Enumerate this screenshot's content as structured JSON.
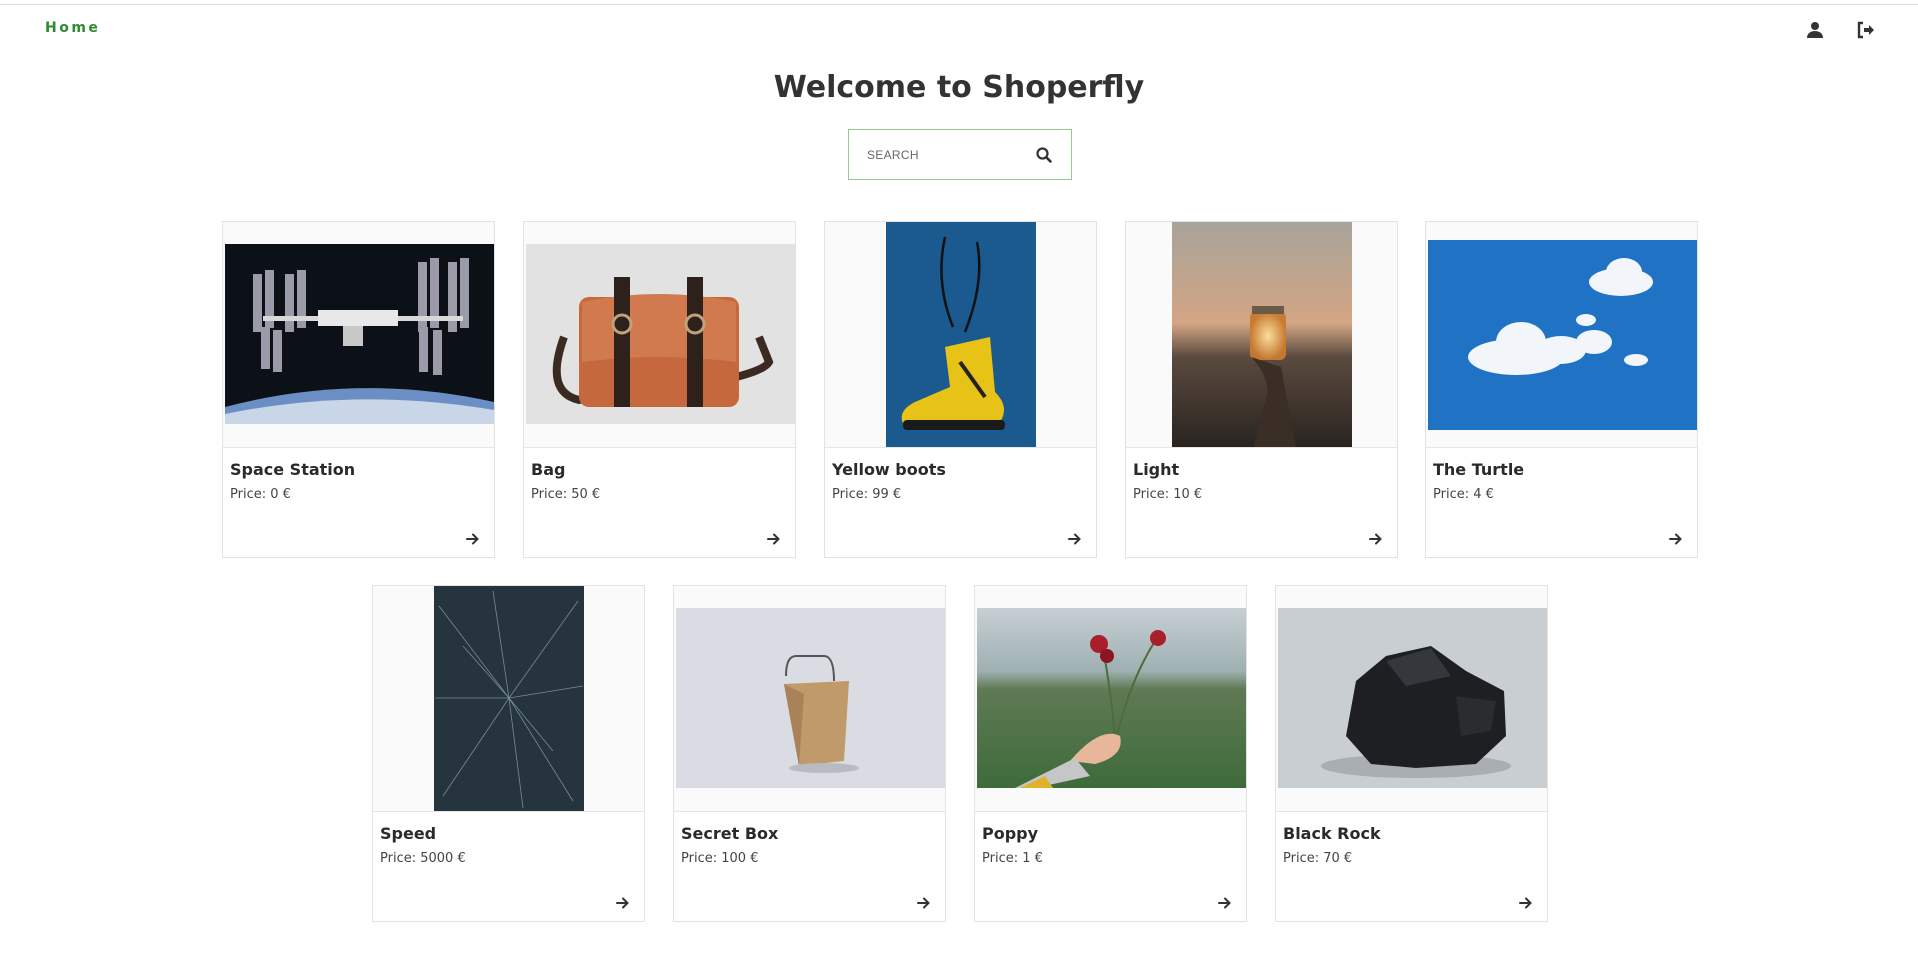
{
  "nav": {
    "home_label": "Home",
    "user_icon": "user-icon",
    "logout_icon": "sign-out-icon"
  },
  "page": {
    "title": "Welcome to Shoperfly"
  },
  "search": {
    "placeholder": "SEARCH",
    "icon": "search-icon"
  },
  "colors": {
    "accent": "#2e8b2e",
    "search_border": "#8fcc8f"
  },
  "products": [
    {
      "name": "Space Station",
      "price_label": "Price:",
      "price": "0",
      "currency": "€",
      "image": "space-station-photo"
    },
    {
      "name": "Bag",
      "price_label": "Price:",
      "price": "50",
      "currency": "€",
      "image": "leather-bag-photo"
    },
    {
      "name": "Yellow boots",
      "price_label": "Price:",
      "price": "99",
      "currency": "€",
      "image": "yellow-boot-photo"
    },
    {
      "name": "Light",
      "price_label": "Price:",
      "price": "10",
      "currency": "€",
      "image": "jar-light-photo"
    },
    {
      "name": "The Turtle",
      "price_label": "Price:",
      "price": "4",
      "currency": "€",
      "image": "clouds-sky-photo"
    },
    {
      "name": "Speed",
      "price_label": "Price:",
      "price": "5000",
      "currency": "€",
      "image": "star-streaks-photo"
    },
    {
      "name": "Secret Box",
      "price_label": "Price:",
      "price": "100",
      "currency": "€",
      "image": "takeout-box-photo"
    },
    {
      "name": "Poppy",
      "price_label": "Price:",
      "price": "1",
      "currency": "€",
      "image": "poppy-flower-photo"
    },
    {
      "name": "Black Rock",
      "price_label": "Price:",
      "price": "70",
      "currency": "€",
      "image": "black-rock-photo"
    }
  ]
}
